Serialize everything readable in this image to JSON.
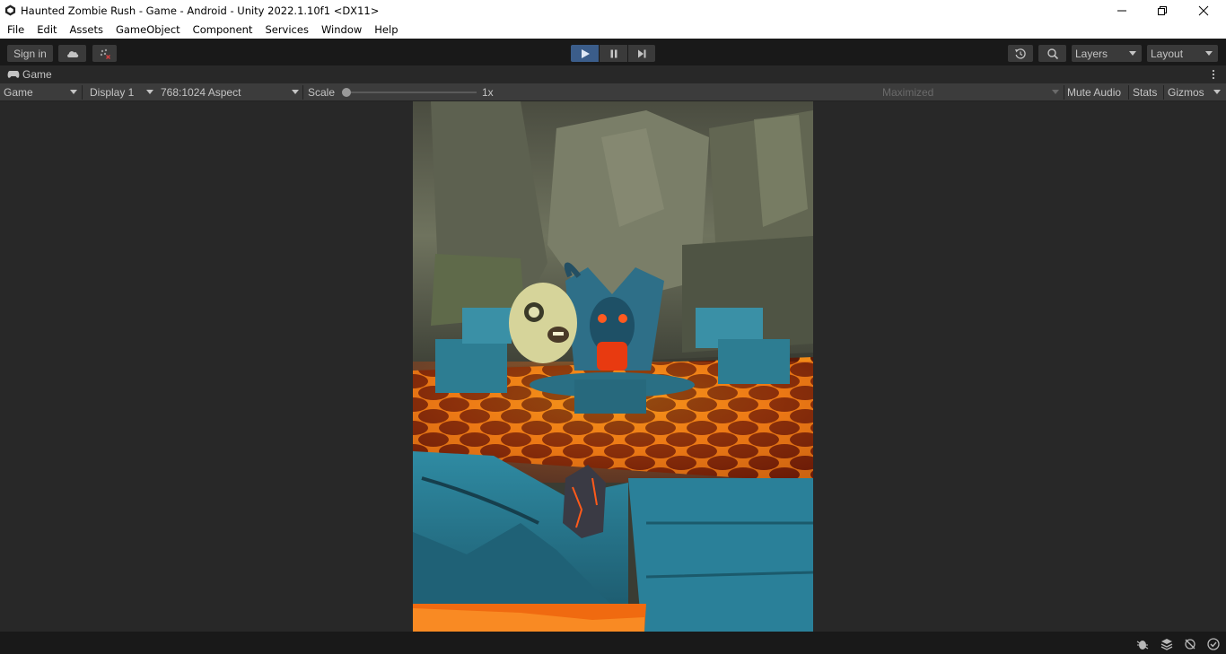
{
  "window": {
    "title": "Haunted Zombie Rush - Game - Android - Unity 2022.1.10f1 <DX11>",
    "minimize_icon": "minimize-icon",
    "maximize_icon": "restore-icon",
    "close_icon": "close-icon"
  },
  "menu": [
    "File",
    "Edit",
    "Assets",
    "GameObject",
    "Component",
    "Services",
    "Window",
    "Help"
  ],
  "toolbar": {
    "sign_in": "Sign in",
    "cloud_icon": "cloud-icon",
    "collab_icon": "collab-icon",
    "play_icon": "play-icon",
    "pause_icon": "pause-icon",
    "step_icon": "step-icon",
    "history_icon": "history-icon",
    "search_icon": "search-icon",
    "layers": "Layers",
    "layout": "Layout",
    "play_active_color": "#3b5d8a"
  },
  "tab": {
    "label": "Game",
    "icon": "gamepad-icon",
    "more_icon": "kebab-menu-icon"
  },
  "gamebar": {
    "view_mode": "Game",
    "display": "Display 1",
    "aspect": "768:1024 Aspect",
    "scale_label": "Scale",
    "scale_value": "1x",
    "scale_level": 0,
    "maximized": "Maximized",
    "mute_audio": "Mute Audio",
    "stats": "Stats",
    "gizmos": "Gizmos"
  },
  "status": {
    "icons": [
      "debug-icon",
      "layers-stack-icon",
      "lighting-icon",
      "check-circle-icon"
    ]
  }
}
